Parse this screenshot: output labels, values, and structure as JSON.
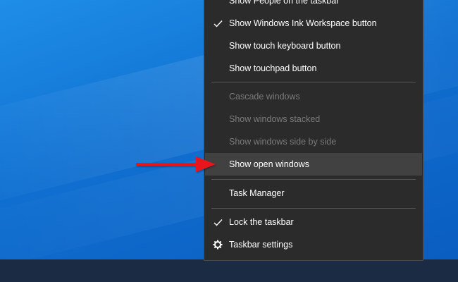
{
  "menu": {
    "items": [
      {
        "label": "Show People on the taskbar",
        "checked": false,
        "disabled": false
      },
      {
        "label": "Show Windows Ink Workspace button",
        "checked": true,
        "disabled": false
      },
      {
        "label": "Show touch keyboard button",
        "checked": false,
        "disabled": false
      },
      {
        "label": "Show touchpad button",
        "checked": false,
        "disabled": false
      },
      {
        "label": "Cascade windows",
        "checked": false,
        "disabled": true
      },
      {
        "label": "Show windows stacked",
        "checked": false,
        "disabled": true
      },
      {
        "label": "Show windows side by side",
        "checked": false,
        "disabled": true
      },
      {
        "label": "Show open windows",
        "checked": false,
        "disabled": false,
        "highlighted": true
      },
      {
        "label": "Task Manager",
        "checked": false,
        "disabled": false
      },
      {
        "label": "Lock the taskbar",
        "checked": true,
        "disabled": false
      },
      {
        "label": "Taskbar settings",
        "checked": false,
        "disabled": false,
        "icon": "gear-icon"
      }
    ]
  },
  "annotation": {
    "icon": "red-arrow-icon",
    "color": "#e8141b"
  },
  "colors": {
    "menu_bg": "#2b2b2b",
    "highlight_bg": "#414141",
    "disabled_text": "#7a7a7a",
    "desktop": "#0f6fd0"
  }
}
